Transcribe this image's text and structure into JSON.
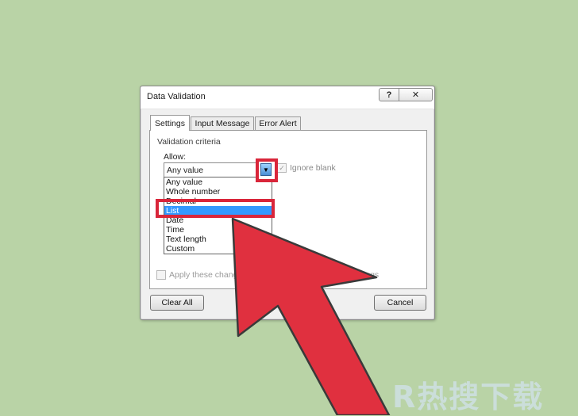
{
  "dialog": {
    "title": "Data Validation",
    "help_glyph": "?",
    "close_glyph": "✕"
  },
  "tabs": [
    {
      "label": "Settings",
      "active": true
    },
    {
      "label": "Input Message",
      "active": false
    },
    {
      "label": "Error Alert",
      "active": false
    }
  ],
  "settings": {
    "group_label": "Validation criteria",
    "allow_label": "Allow:",
    "allow_value": "Any value",
    "dropdown_glyph": "▼",
    "ignore_blank_label": "Ignore blank",
    "ignore_blank_checked": true,
    "check_glyph": "✓",
    "options": [
      "Any value",
      "Whole number",
      "Decimal",
      "List",
      "Date",
      "Time",
      "Text length",
      "Custom"
    ],
    "selected_option": "List",
    "apply_label": "Apply these changes",
    "apply_suffix": "settings"
  },
  "buttons": {
    "clear_all": "Clear All",
    "cancel": "Cancel"
  },
  "annotation": {
    "highlight_color": "#d9263a",
    "arrow_color": "#e0303f"
  },
  "watermark": "R热搜下载"
}
